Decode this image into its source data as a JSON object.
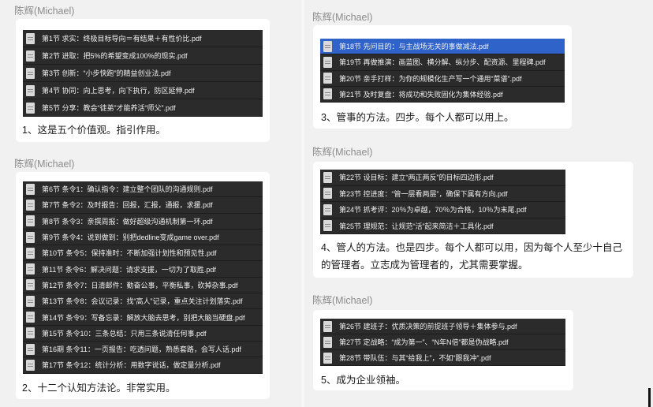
{
  "messages": [
    {
      "sender": "陈辉(Michael)",
      "files": [
        "第1节 求实：终极目标导向＝有结果＋有性价比.pdf",
        "第2节 进取：把5%的希望变成100%的现实.pdf",
        "第3节 创新：“小步快跑”的精益创业法.pdf",
        "第4节 协同：向上思考，向下执行，防区延伸.pdf",
        "第5节 分享：教会“徒弟”才能养活“师父”.pdf"
      ],
      "selected_index": -1,
      "caption": "1、这是五个价值观。指引作用。"
    },
    {
      "sender": "陈辉(Michael)",
      "files": [
        "第6节 条令1：确认指令：建立整个团队的沟通规则.pdf",
        "第7节 条令2：及时报告：回报，汇报，通报，求援.pdf",
        "第8节 条令3：亲撰周报：做好超级沟通机制第一环.pdf",
        "第9节 条令4：说到做到：别把dedline变成game over.pdf",
        "第10节 条令5：保持准时：不断加强计划性和预见性.pdf",
        "第11节 条令6：解决问题：请求支援，一切为了取胜.pdf",
        "第12节 条令7：日清邮件：勤奋公事，平衡私事，砍掉杂事.pdf",
        "第13节 条令8：会议记录：找“高人”记录，重点关注计划落实.pdf",
        "第14节 条令9：写备忘录：解放大脑去思考，别把大脑当硬盘.pdf",
        "第15节 条令10：三条总结：只用三条说清任何事.pdf",
        "第16期 条令11：一页报告：吃透问题，熟悉套路，会写人话.pdf",
        "第17节 条令12：统计分析：用数字说话，做定量分析.pdf"
      ],
      "selected_index": -1,
      "caption": "2、十二个认知方法论。非常实用。"
    },
    {
      "sender": "陈辉(Michael)",
      "files": [
        "第18节 先问目的：与主战场无关的事做减法.pdf",
        "第19节 再做推演：画蓝图、横分解、纵分步、配资源、里程碑.pdf",
        "第20节 亲手打样：为你的规模化生产写一个通用“菜谱”.pdf",
        "第21节 及时复盘：将成功和失败固化为集体经验.pdf"
      ],
      "selected_index": 0,
      "caption": "3、管事的方法。四步。每个人都可以用上。"
    },
    {
      "sender": "陈辉(Michael)",
      "files": [
        "第22节 设目标：建立“两正两反”的目标四边形.pdf",
        "第23节 控进度：“管一层看两层”，确保下属有方向.pdf",
        "第24节 抓考评：20％为卓越，70％为合格，10％为末尾.pdf",
        "第25节 理规范：让规范“活”起来简洁＋工具化.pdf"
      ],
      "selected_index": -1,
      "caption": "4、管人的方法。也是四步。每个人都可以用，因为每个人至少十自己的管理者。立志成为管理者的，尤其需要掌握。"
    },
    {
      "sender": "陈辉(Michael)",
      "files": [
        "第26节 建班子：优质决策的前提班子领导＋集体参与.pdf",
        "第27节 定战略：“成为第一”、“N年N倍”都是伪战略.pdf",
        "第28节 带队伍：与其“给我上”，不如“跟我冲”.pdf"
      ],
      "selected_index": -1,
      "caption": "5、成为企业领袖。"
    }
  ],
  "colors": {
    "background": "#f1f1f1",
    "bubble": "#ffffff",
    "file_panel": "#2b2b2b",
    "selected_row": "#2f63c9",
    "sender_text": "#8c8c8c"
  },
  "icons": [
    "pdf-file-icon"
  ]
}
